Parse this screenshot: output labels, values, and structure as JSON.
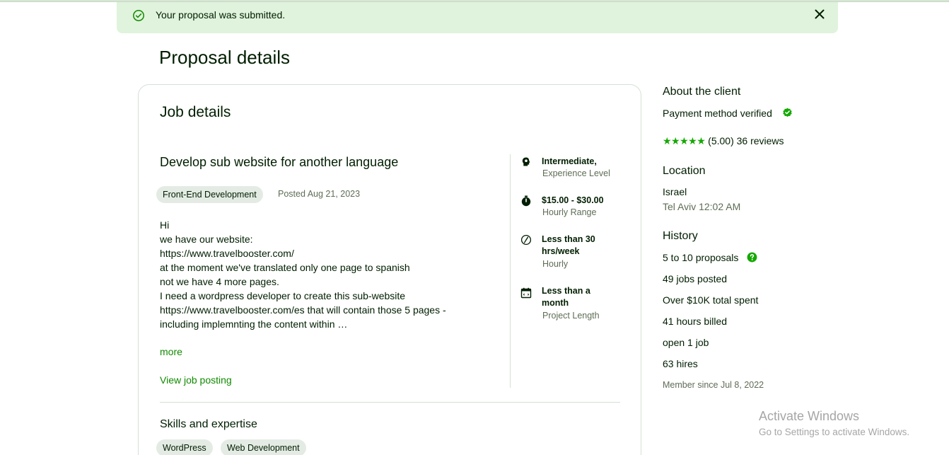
{
  "banner": {
    "message": "Your proposal was submitted."
  },
  "page": {
    "title": "Proposal details"
  },
  "job": {
    "section_title": "Job details",
    "title": "Develop sub website for another language",
    "category": "Front-End Development",
    "posted": "Posted Aug 21, 2023",
    "description_lines": [
      "Hi",
      "we have our website:",
      "https://www.travelbooster.com/",
      "at the moment we've translated only one page to spanish",
      "not we have 4 more pages.",
      "I need a wordpress developer to create this sub-website",
      "https://www.travelbooster.com/es that will contain those 5 pages -",
      "including implemnting the content within …"
    ],
    "more_label": "more",
    "view_label": "View job posting",
    "features": [
      {
        "icon": "experience-level-icon",
        "value": "Intermediate,",
        "label": "Experience Level"
      },
      {
        "icon": "clock-icon",
        "value": "$15.00 - $30.00",
        "label": "Hourly Range"
      },
      {
        "icon": "hours-icon",
        "value": "Less than 30 hrs/week",
        "label": "Hourly"
      },
      {
        "icon": "calendar-icon",
        "value": "Less than a month",
        "label": "Project Length"
      }
    ],
    "skills_title": "Skills and expertise",
    "skills": [
      "WordPress",
      "Web Development"
    ]
  },
  "client": {
    "about_title": "About the client",
    "payment": "Payment method verified",
    "rating_stars": 5,
    "rating_text": "(5.00) 36 reviews",
    "location_title": "Location",
    "country": "Israel",
    "city_time": "Tel Aviv 12:02 AM",
    "history_title": "History",
    "proposals": "5 to 10 proposals",
    "jobs_posted": "49 jobs posted",
    "total_spent": "Over $10K total spent",
    "hours_billed": "41 hours billed",
    "open_jobs": "open 1 job",
    "hires": "63 hires",
    "member_since": "Member since Jul 8, 2022"
  },
  "watermark": {
    "title": "Activate Windows",
    "subtitle": "Go to Settings to activate Windows."
  },
  "colors": {
    "accent": "#108a00",
    "banner_bg": "#e0f3dc",
    "text": "#001e00",
    "muted": "#5e6d55",
    "tag_bg": "#e4ebe4"
  }
}
